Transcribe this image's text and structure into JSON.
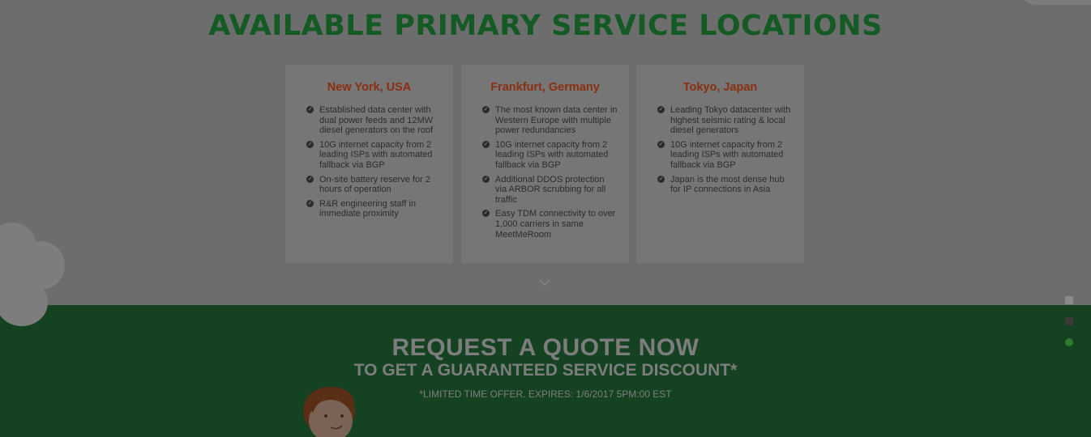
{
  "heading": "AVAILABLE PRIMARY SERVICE LOCATIONS",
  "locations": [
    {
      "name": "New York, USA",
      "features": [
        "Established data center with dual power feeds and 12MW diesel generators on the roof",
        "10G internet capacity from 2 leading ISPs with automated fallback via BGP",
        "On-site battery reserve for 2 hours of operation",
        "R&R engineering staff in immediate proximity"
      ]
    },
    {
      "name": "Frankfurt, Germany",
      "features": [
        "The most known data center in Western Europe with multiple power redundancies",
        "10G internet capacity from 2 leading ISPs with automated fallback via BGP",
        "Additional DDOS protection via ARBOR scrubbing for all traffic",
        "Easy TDM connectivity to over 1,000 carriers in same MeetMeRoom"
      ]
    },
    {
      "name": "Tokyo, Japan",
      "features": [
        "Leading Tokyo datacenter with highest seismic rating & local diesel generators",
        "10G internet capacity from 2 leading ISPs with automated fallback via BGP",
        "Japan is the most dense hub for IP connections in Asia"
      ]
    }
  ],
  "quote": {
    "title": "REQUEST A QUOTE NOW",
    "subtitle": "TO GET A GUARANTEED SERVICE DISCOUNT*",
    "offer": "*LIMITED TIME OFFER. EXPIRES: 1/6/2017 5PM:00 EST"
  },
  "icons": {
    "check": "check-circle-icon",
    "scroll": "chevron-down-icon",
    "mascot": "mascot-face-icon"
  },
  "colors": {
    "heading": "#145a24",
    "city": "#8a2f10",
    "band": "#154322",
    "nav_dot_inactive": "#8a8a8a",
    "nav_dot_mid": "#3a3a3a",
    "nav_dot_active": "#2f7a2f"
  }
}
